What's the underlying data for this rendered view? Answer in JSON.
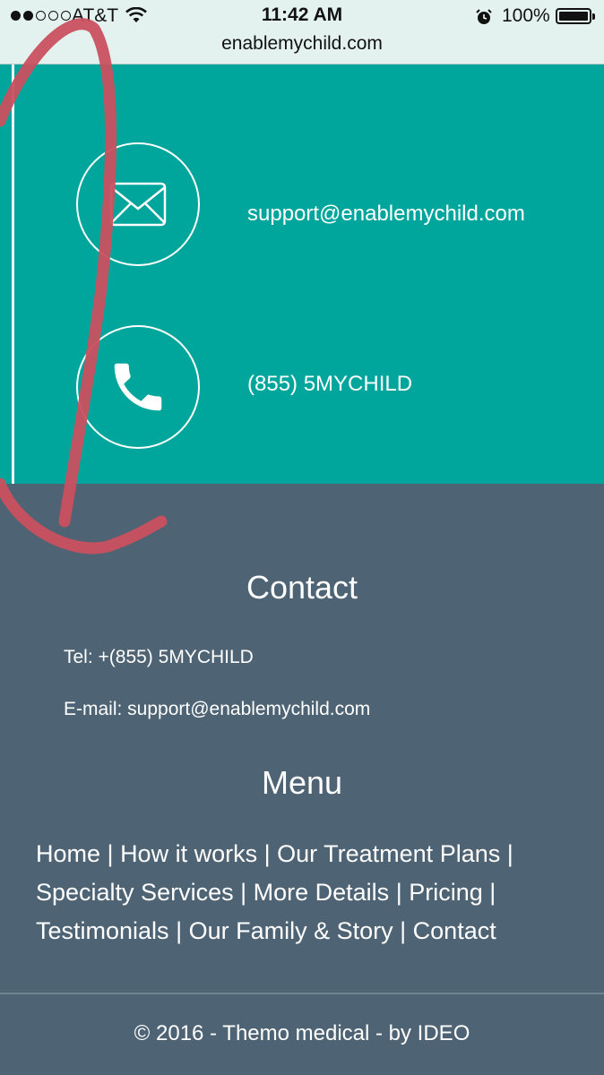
{
  "status_bar": {
    "carrier": "AT&T",
    "time": "11:42 AM",
    "battery": "100%"
  },
  "browser": {
    "url": "enablemychild.com"
  },
  "contact_banner": {
    "email": "support@enablemychild.com",
    "phone": "(855) 5MYCHILD"
  },
  "footer": {
    "contact_title": "Contact",
    "tel": "Tel: +(855) 5MYCHILD",
    "email": "E-mail:  support@enablemychild.com",
    "menu_title": "Menu",
    "menu": [
      "Home",
      "How it works",
      "Our Treatment Plans",
      "Specialty Services",
      "More Details",
      "Pricing",
      "Testimonials",
      "Our Family & Story",
      "Contact"
    ],
    "separator": "|",
    "copyright": "© 2016 - Themo medical - by IDEO"
  },
  "colors": {
    "teal": "#00a69c",
    "slate": "#4e6373",
    "annotation": "#c9505f"
  }
}
